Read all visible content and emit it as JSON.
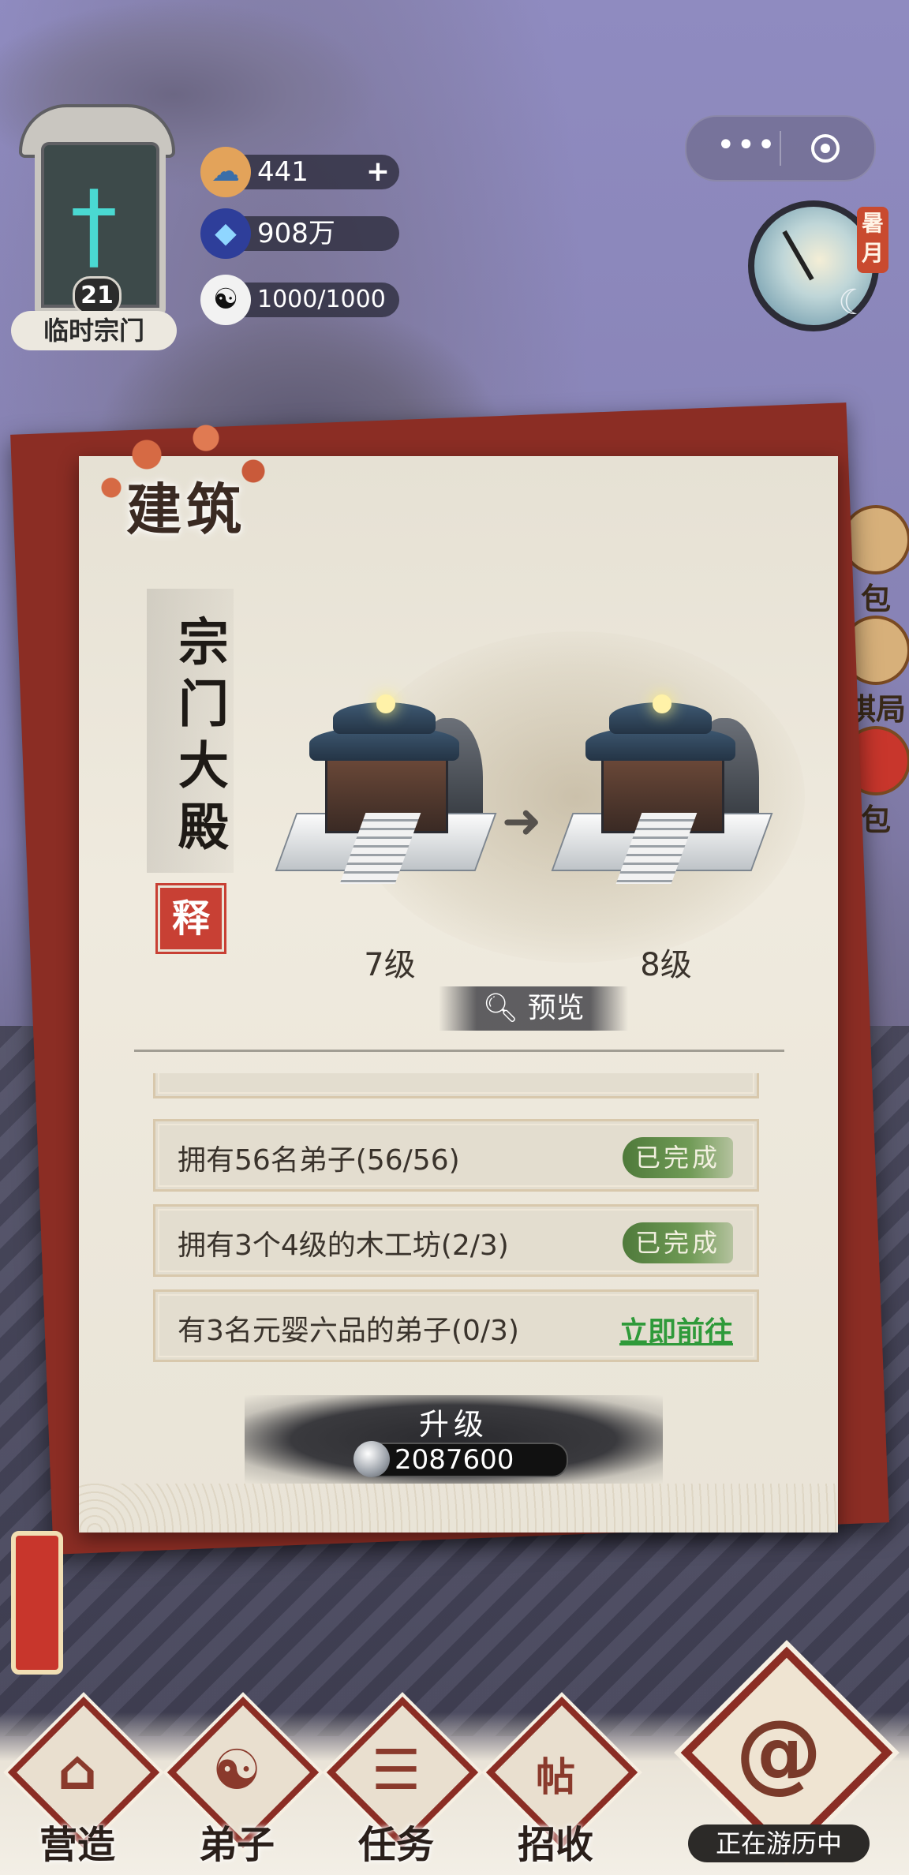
{
  "sect": {
    "name": "临时宗门",
    "level": "21"
  },
  "resources": [
    {
      "icon": "cloud-token-icon",
      "value": "441",
      "has_plus": true
    },
    {
      "icon": "spirit-crystal-icon",
      "value": "908万",
      "has_plus": false
    },
    {
      "icon": "yin-yang-icon",
      "value": "1000/1000",
      "has_plus": false
    }
  ],
  "season": "暑月",
  "side_buttons": [
    "包",
    "棋局",
    "包"
  ],
  "panel": {
    "title": "建筑",
    "building_name": "宗门大殿",
    "seal": "释",
    "level_from": "7级",
    "level_to": "8级",
    "preview_label": "预览",
    "tasks": [
      {
        "text": "拥有56名弟子(56/56)",
        "status": "done",
        "status_label": "已完成"
      },
      {
        "text": "拥有3个4级的木工坊(2/3)",
        "status": "done",
        "status_label": "已完成"
      },
      {
        "text": "有3名元婴六品的弟子(0/3)",
        "status": "go",
        "status_label": "立即前往"
      }
    ],
    "upgrade_label": "升级",
    "upgrade_cost": "2087600"
  },
  "nav": [
    {
      "label": "营造",
      "glyph": "⌂"
    },
    {
      "label": "弟子",
      "glyph": "☯"
    },
    {
      "label": "任务",
      "glyph": "☰"
    },
    {
      "label": "招收",
      "glyph": "帖"
    }
  ],
  "travel_label": "正在游历中"
}
